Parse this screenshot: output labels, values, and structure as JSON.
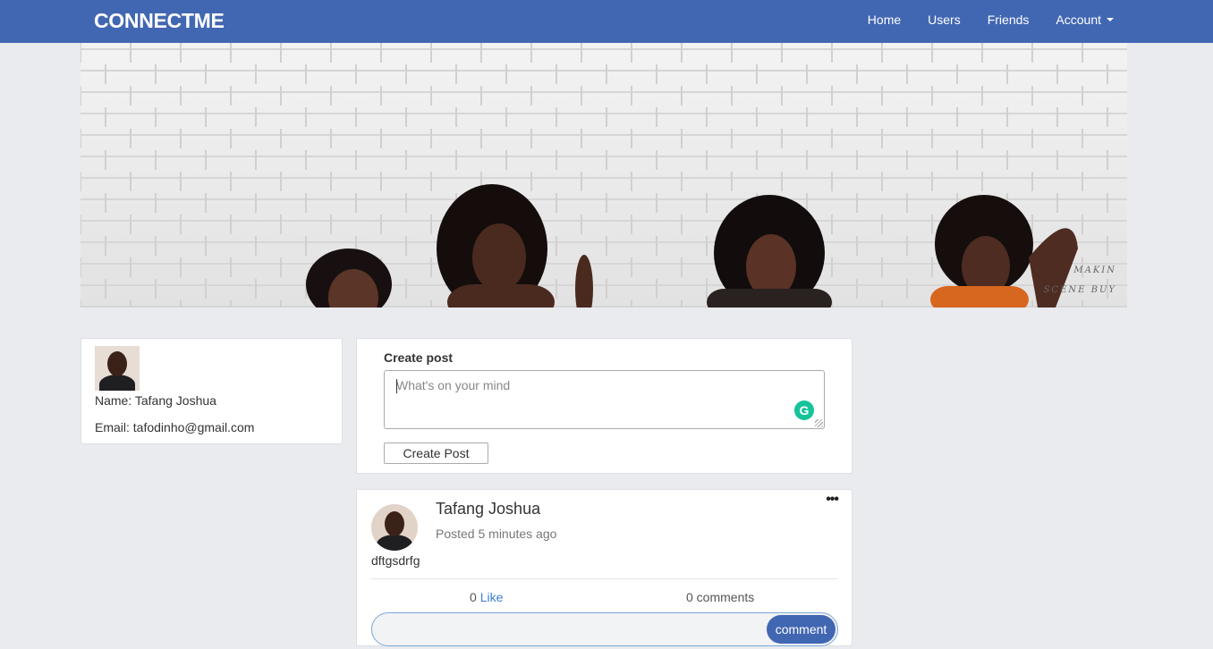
{
  "navbar": {
    "brand": "CONNECTME",
    "links": [
      "Home",
      "Users",
      "Friends",
      "Account"
    ],
    "color": "#4267b2"
  },
  "cover": {
    "watermark_line1": "MAKIN",
    "watermark_line2": "SCENE BUY"
  },
  "profile": {
    "name_label": "Name: Tafang Joshua",
    "email_label": "Email: tafodinho@gmail.com"
  },
  "create_post": {
    "title": "Create post",
    "placeholder": "What's on your mind",
    "button_label": "Create Post",
    "grammarly_icon": "G"
  },
  "post": {
    "author": "Tafang Joshua",
    "time": "Posted 5 minutes ago",
    "body": "dftgsdrfg",
    "more_icon": "•••",
    "like_count": "0",
    "like_label": "Like",
    "comments_count": "0 comments",
    "comment_button": "comment"
  }
}
